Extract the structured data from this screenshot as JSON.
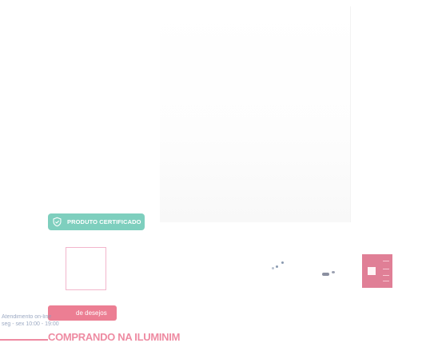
{
  "product": {
    "badge_label": "PRODUTO CERTIFICADO"
  },
  "chat": {
    "button_label": "de desejos",
    "status_line1": "Atendimento on-line",
    "status_line2": "seg - sex 10:00 - 19:00"
  },
  "section": {
    "heading": "COMPRANDO NA ILUMINIM"
  },
  "colors": {
    "badge": "#7ecfbe",
    "accent": "#ec7e93",
    "thumb_border": "#f2b6cc"
  }
}
